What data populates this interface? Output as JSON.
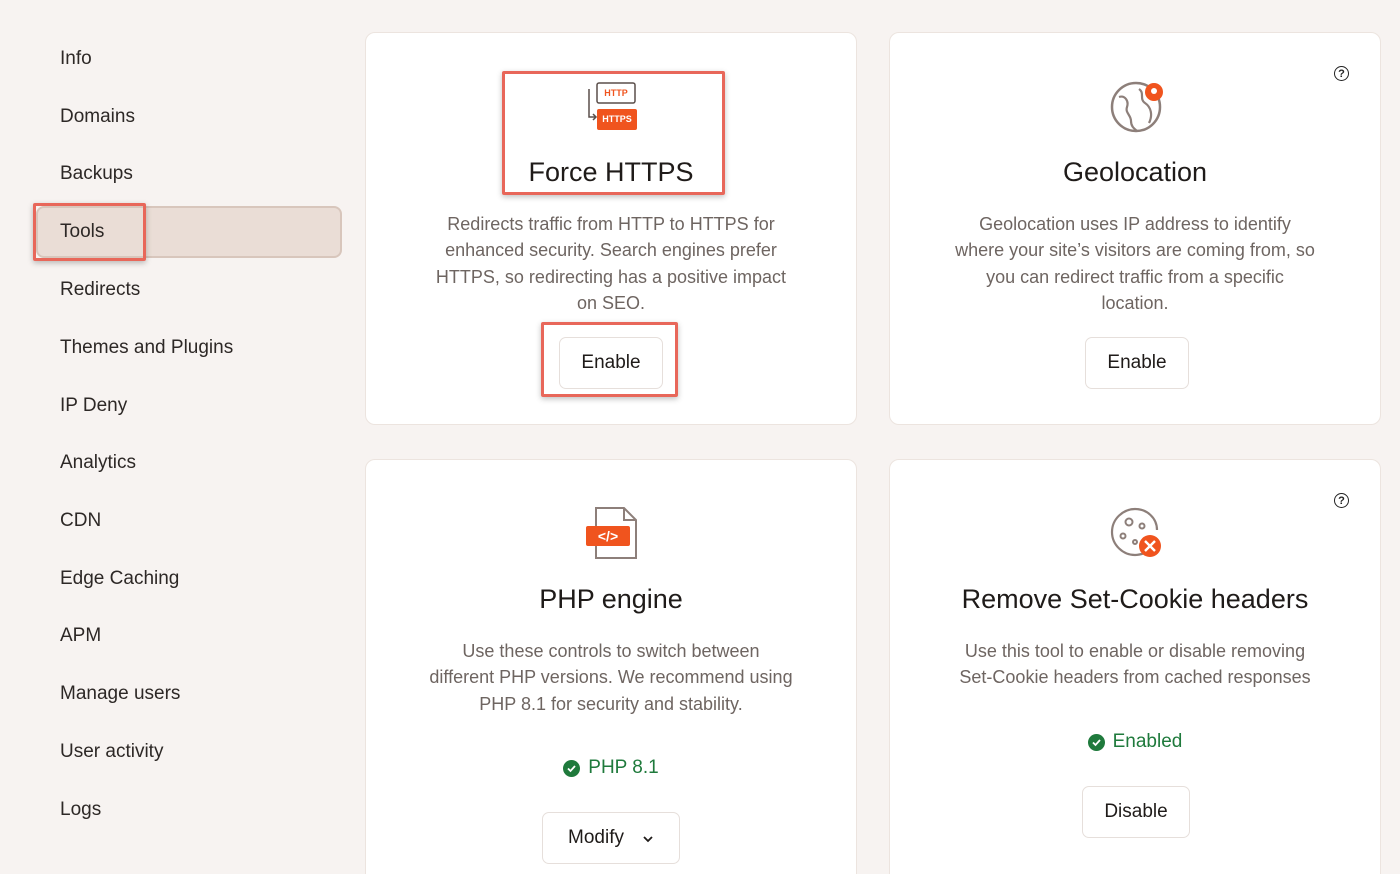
{
  "sidebar": {
    "items": [
      {
        "label": "Info"
      },
      {
        "label": "Domains"
      },
      {
        "label": "Backups"
      },
      {
        "label": "Tools"
      },
      {
        "label": "Redirects"
      },
      {
        "label": "Themes and Plugins"
      },
      {
        "label": "IP Deny"
      },
      {
        "label": "Analytics"
      },
      {
        "label": "CDN"
      },
      {
        "label": "Edge Caching"
      },
      {
        "label": "APM"
      },
      {
        "label": "Manage users"
      },
      {
        "label": "User activity"
      },
      {
        "label": "Logs"
      }
    ],
    "active": "Tools"
  },
  "cards": {
    "force_https": {
      "icon": "http-https-icon",
      "icon_http": "HTTP",
      "icon_https": "HTTPS",
      "title": "Force HTTPS",
      "desc": [
        "Redirects traffic from HTTP to HTTPS for",
        "enhanced security. Search engines prefer",
        "HTTPS, so redirecting has a positive impact",
        "on SEO."
      ],
      "button": "Enable"
    },
    "geolocation": {
      "icon": "globe-pin-icon",
      "title": "Geolocation",
      "desc": [
        "Geolocation uses IP address to identify",
        "where your site’s visitors are coming from, so",
        "you can redirect traffic from a specific",
        "location."
      ],
      "button": "Enable"
    },
    "php_engine": {
      "icon": "code-file-icon",
      "icon_code": "</>",
      "title": "PHP engine",
      "desc": [
        "Use these controls to switch between",
        "different PHP versions. We recommend using",
        "PHP 8.1 for security and stability."
      ],
      "status": "PHP 8.1",
      "button": "Modify"
    },
    "set_cookie": {
      "icon": "cookie-remove-icon",
      "title": "Remove Set-Cookie headers",
      "desc": [
        "Use this tool to enable or disable removing",
        "Set-Cookie headers from cached responses"
      ],
      "status": "Enabled",
      "button": "Disable"
    }
  },
  "help_glyph": "?",
  "colors": {
    "accent": "#f0541e",
    "success": "#1f7a3c",
    "highlight": "#e8675a",
    "active_nav": "#eaddd6"
  }
}
